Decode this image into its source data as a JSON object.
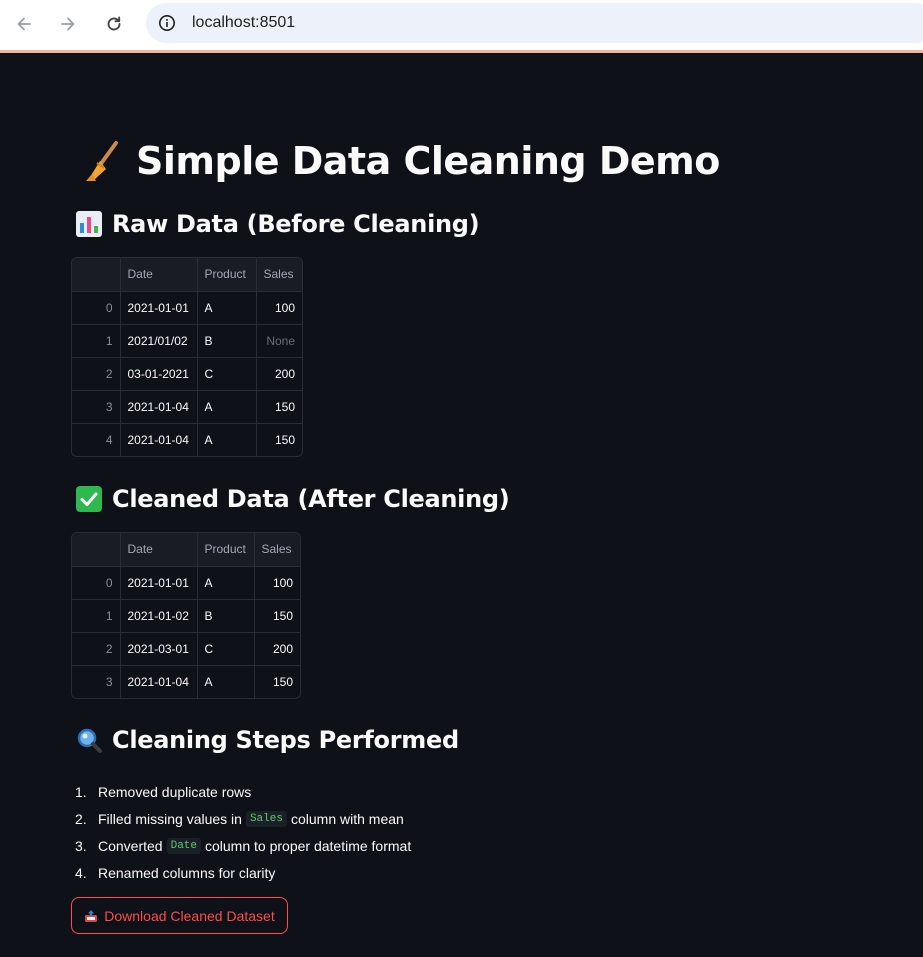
{
  "browser": {
    "url": "localhost:8501"
  },
  "app": {
    "title": "Simple Data Cleaning Demo",
    "raw_heading": "Raw Data (Before Cleaning)",
    "clean_heading": "Cleaned Data (After Cleaning)",
    "steps_heading": "Cleaning Steps Performed",
    "download_label": "Download Cleaned Dataset"
  },
  "raw_table": {
    "columns": [
      "",
      "Date",
      "Product",
      "Sales"
    ],
    "rows": [
      [
        "0",
        "2021-01-01",
        "A",
        "100"
      ],
      [
        "1",
        "2021/01/02",
        "B",
        "None"
      ],
      [
        "2",
        "03-01-2021",
        "C",
        "200"
      ],
      [
        "3",
        "2021-01-04",
        "A",
        "150"
      ],
      [
        "4",
        "2021-01-04",
        "A",
        "150"
      ]
    ]
  },
  "clean_table": {
    "columns": [
      "",
      "Date",
      "Product",
      "Sales"
    ],
    "rows": [
      [
        "0",
        "2021-01-01",
        "A",
        "100"
      ],
      [
        "1",
        "2021-01-02",
        "B",
        "150"
      ],
      [
        "2",
        "2021-03-01",
        "C",
        "200"
      ],
      [
        "3",
        "2021-01-04",
        "A",
        "150"
      ]
    ]
  },
  "steps": [
    {
      "num": "1.",
      "pre": "Removed duplicate rows",
      "code": "",
      "post": ""
    },
    {
      "num": "2.",
      "pre": "Filled missing values in",
      "code": "Sales",
      "post": "column with mean"
    },
    {
      "num": "3.",
      "pre": "Converted",
      "code": "Date",
      "post": "column to proper datetime format"
    },
    {
      "num": "4.",
      "pre": "Renamed columns for clarity",
      "code": "",
      "post": ""
    }
  ],
  "icons": {
    "title": "broom-icon",
    "raw": "bar-chart-icon",
    "clean": "check-mark-button-icon",
    "steps": "magnifying-glass-icon",
    "download": "outbox-tray-icon"
  },
  "colors": {
    "background": "#0e1117",
    "accent": "#ff4b4b",
    "code_text": "#5ec96f"
  }
}
